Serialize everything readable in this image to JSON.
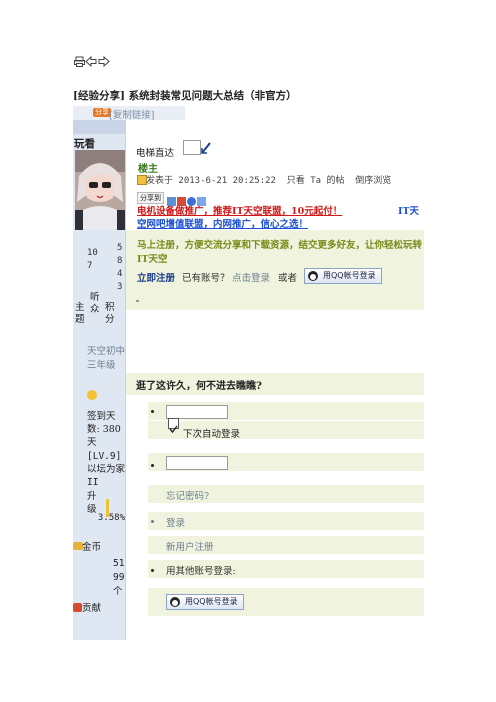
{
  "toolbar": {
    "icons": [
      "print-icon",
      "back-arrow-icon",
      "forward-arrow-icon"
    ]
  },
  "post_title": "[经验分享] 系统封装常见问题大总结（非官方）",
  "copy_bar": {
    "badge": "分享",
    "link": "[复制链接]"
  },
  "author": {
    "name": "玩看",
    "stats": {
      "topics": "10 7",
      "listeners": "5 8 4 3",
      "labels": [
        "主题",
        "听众",
        "积分"
      ]
    },
    "group": "天空初中三年级",
    "checkin": "签到天数: 380 天",
    "level": "[LV.9]以坛为家II",
    "upgrade_label": "升级",
    "upgrade_percent": "3.58%",
    "coins_label": "金币",
    "coins_value": "5199 个",
    "contrib_label": "贡献"
  },
  "post": {
    "elevator_label": "电梯直达",
    "op_label": "楼主",
    "posted_meta": "发表于 2013-6-21 20:25:22  只看 Ta 的帖  倒序浏览",
    "share_label": "分享到"
  },
  "ads": {
    "line1": "电机设备做推广，推荐IT天空联盟，10元起付！",
    "line1_right": "IT天",
    "line2": "空网吧增值联盟，内网推广，信心之选！",
    "line3": "马上注册，方便交流分享和下载资源，结交更多好友，让你轻松玩转IT天空"
  },
  "register_bar": {
    "register": "立即注册",
    "have_account": "已有账号？",
    "login_link": "点击登录",
    "or": "或者",
    "qq_login": "用QQ帐号登录"
  },
  "login_panel": {
    "heading": "逛了这许久，何不进去瞧瞧?",
    "remember": "下次自动登录",
    "forgot": "忘记密码?",
    "login": "登录",
    "register": "新用户注册",
    "other_login": "用其他账号登录:",
    "qq_login": "用QQ帐号登录"
  },
  "colors": {
    "ad_red": "#d01818",
    "ad_blue": "#1b4fd4",
    "green_text": "#7a8a1a",
    "register_blue": "#1a3d8a",
    "muted": "#6a7f8f",
    "sidebar_bg": "#dfe7f2",
    "panel_bg": "#f0f3de"
  }
}
